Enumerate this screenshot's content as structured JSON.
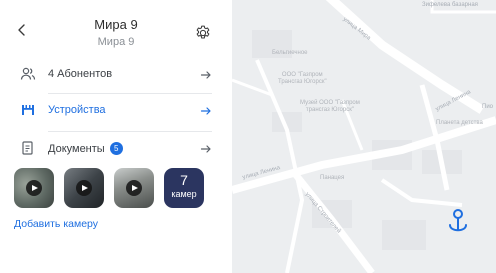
{
  "header": {
    "title": "Мира 9",
    "subtitle": "Мира 9",
    "back_icon": "chevron-left-icon",
    "settings_icon": "gear-icon"
  },
  "menu": [
    {
      "label": "4 Абонентов",
      "icon": "users-icon",
      "active": false
    },
    {
      "label": "Устройства",
      "icon": "turnstile-icon",
      "active": true
    },
    {
      "label": "Документы",
      "icon": "document-icon",
      "badge": "5",
      "active": false
    }
  ],
  "cameras": {
    "thumbnails": [
      "camera-thumb-1",
      "camera-thumb-2",
      "camera-thumb-3"
    ],
    "more_count": "7",
    "more_label": "камер",
    "add_label": "Добавить камеру"
  },
  "map": {
    "top_label": "Зифелева базарная",
    "roads": {
      "mira": "улица Мира",
      "lenina_top": "улица Ленина",
      "lenina_left": "улица Ленина",
      "stroiteley": "улица Строителей",
      "pio": "Пио"
    },
    "pois": {
      "poi1": "Бельгиечное",
      "poi2": "ООО \"Газпром\nТрансгаз Югорск\"",
      "poi3": "Музей ООО \"Газпром\nтрансгаз Югорск\"",
      "poi4": "Панацея",
      "poi5": "Планета детства"
    }
  },
  "colors": {
    "accent": "#1f6fe0",
    "camera_more_bg": "#2b3560",
    "map_bg": "#eceef0"
  }
}
